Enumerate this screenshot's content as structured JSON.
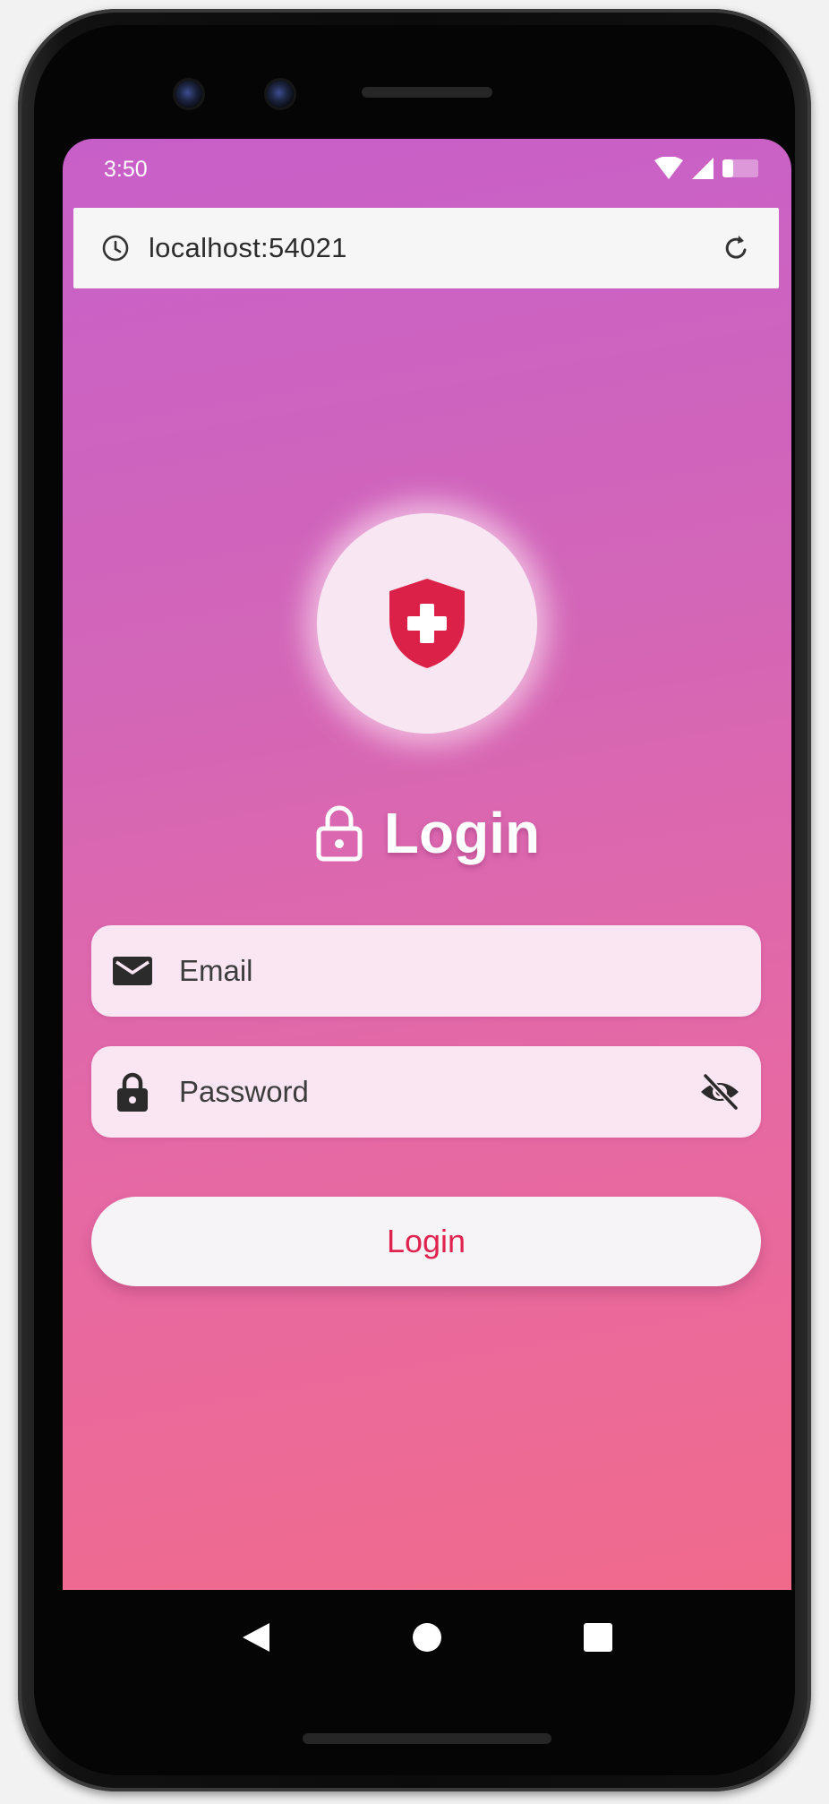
{
  "status_bar": {
    "time": "3:50"
  },
  "address_bar": {
    "url": "localhost:54021"
  },
  "login": {
    "title": "Login",
    "email_placeholder": "Email",
    "password_placeholder": "Password",
    "button_label": "Login"
  },
  "colors": {
    "gradient_start": "#c75fc9",
    "gradient_end": "#f06a8c",
    "accent": "#e0234e",
    "field_bg": "#f9e6f2"
  },
  "icons": {
    "logo": "shield-cross-icon",
    "title": "lock-outline-icon",
    "email": "mail-icon",
    "password": "lock-icon",
    "visibility": "eye-off-icon"
  }
}
